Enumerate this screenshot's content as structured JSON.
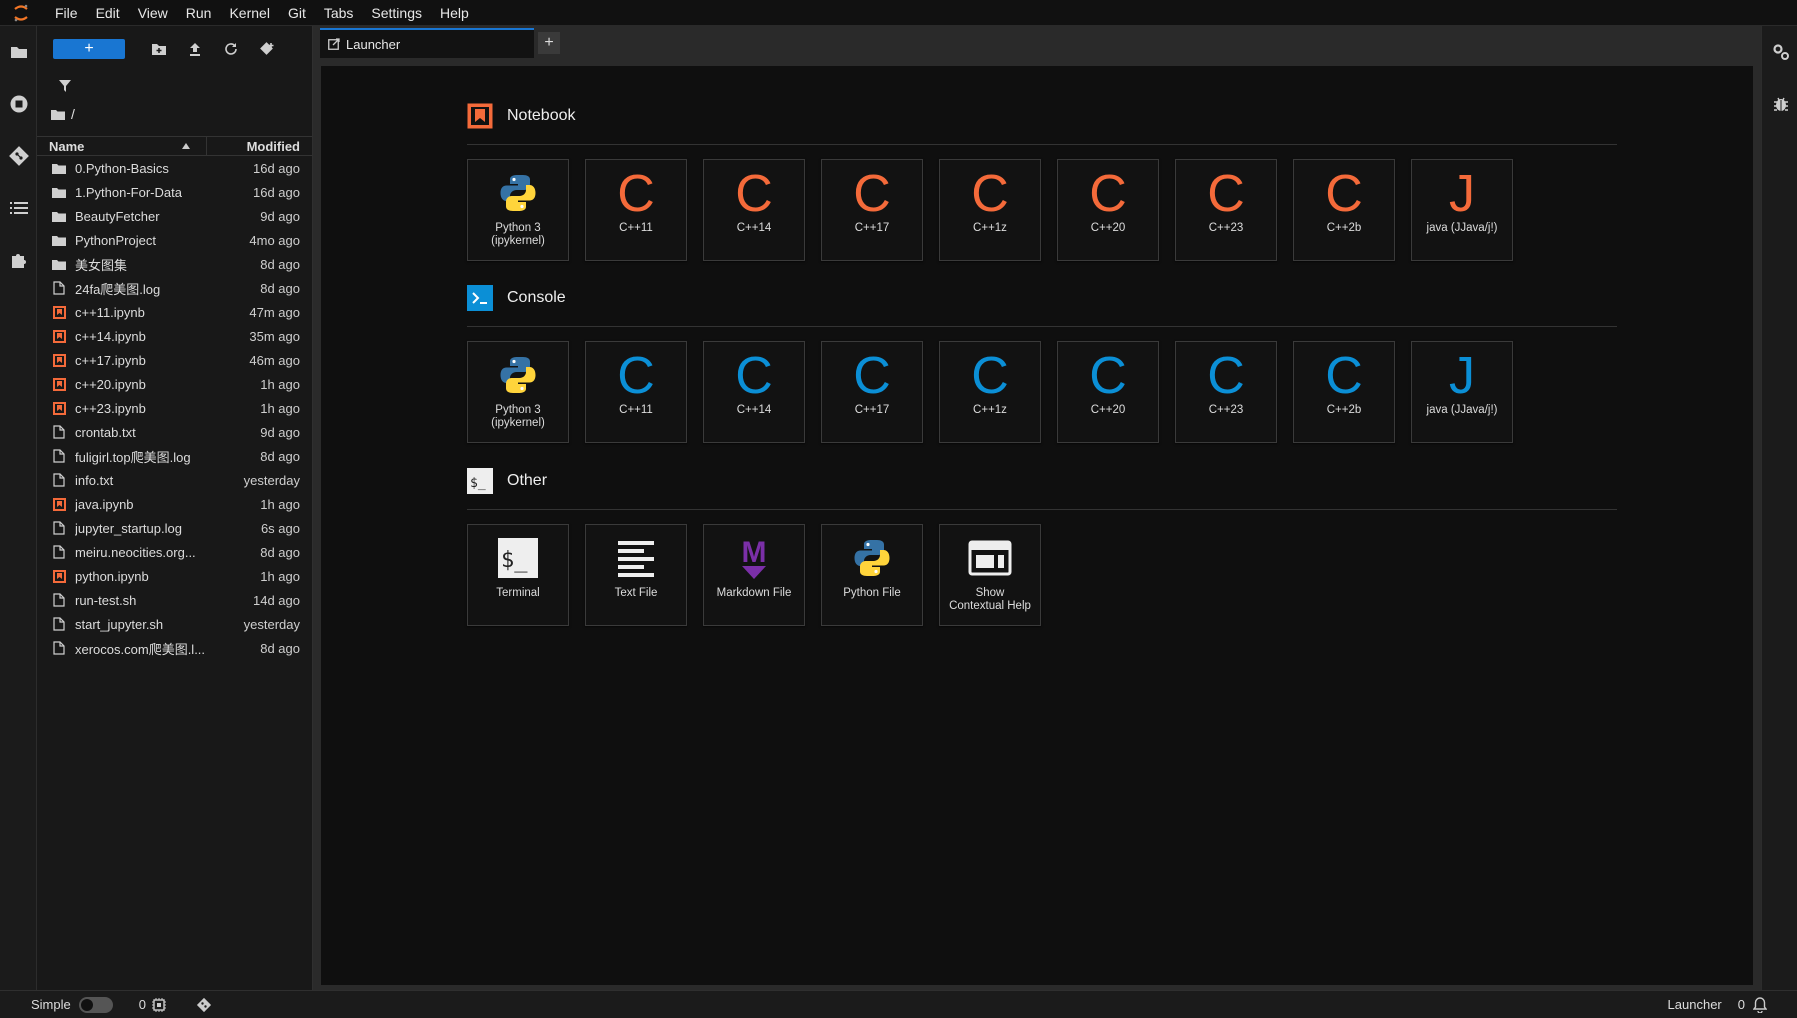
{
  "menu": [
    "File",
    "Edit",
    "View",
    "Run",
    "Kernel",
    "Git",
    "Tabs",
    "Settings",
    "Help"
  ],
  "filebrowser": {
    "new_label": "+",
    "path": "/",
    "col_name": "Name",
    "col_modified": "Modified",
    "files": [
      {
        "name": "0.Python-Basics",
        "modified": "16d ago",
        "type": "folder"
      },
      {
        "name": "1.Python-For-Data",
        "modified": "16d ago",
        "type": "folder"
      },
      {
        "name": "BeautyFetcher",
        "modified": "9d ago",
        "type": "folder"
      },
      {
        "name": "PythonProject",
        "modified": "4mo ago",
        "type": "folder"
      },
      {
        "name": "美女图集",
        "modified": "8d ago",
        "type": "folder"
      },
      {
        "name": "24fa爬美图.log",
        "modified": "8d ago",
        "type": "file"
      },
      {
        "name": "c++11.ipynb",
        "modified": "47m ago",
        "type": "notebook"
      },
      {
        "name": "c++14.ipynb",
        "modified": "35m ago",
        "type": "notebook"
      },
      {
        "name": "c++17.ipynb",
        "modified": "46m ago",
        "type": "notebook"
      },
      {
        "name": "c++20.ipynb",
        "modified": "1h ago",
        "type": "notebook"
      },
      {
        "name": "c++23.ipynb",
        "modified": "1h ago",
        "type": "notebook"
      },
      {
        "name": "crontab.txt",
        "modified": "9d ago",
        "type": "file"
      },
      {
        "name": "fuligirl.top爬美图.log",
        "modified": "8d ago",
        "type": "file"
      },
      {
        "name": "info.txt",
        "modified": "yesterday",
        "type": "file"
      },
      {
        "name": "java.ipynb",
        "modified": "1h ago",
        "type": "notebook"
      },
      {
        "name": "jupyter_startup.log",
        "modified": "6s ago",
        "type": "file"
      },
      {
        "name": "meiru.neocities.org...",
        "modified": "8d ago",
        "type": "file"
      },
      {
        "name": "python.ipynb",
        "modified": "1h ago",
        "type": "notebook"
      },
      {
        "name": "run-test.sh",
        "modified": "14d ago",
        "type": "file"
      },
      {
        "name": "start_jupyter.sh",
        "modified": "yesterday",
        "type": "file"
      },
      {
        "name": "xerocos.com爬美图.l...",
        "modified": "8d ago",
        "type": "file"
      }
    ]
  },
  "tab": {
    "label": "Launcher",
    "add_label": "+"
  },
  "launcher": {
    "notebook": {
      "title": "Notebook",
      "cards": [
        {
          "kind": "python",
          "line1": "Python 3",
          "line2": "(ipykernel)"
        },
        {
          "kind": "letter",
          "letter": "C",
          "line1": "C++11"
        },
        {
          "kind": "letter",
          "letter": "C",
          "line1": "C++14"
        },
        {
          "kind": "letter",
          "letter": "C",
          "line1": "C++17"
        },
        {
          "kind": "letter",
          "letter": "C",
          "line1": "C++1z"
        },
        {
          "kind": "letter",
          "letter": "C",
          "line1": "C++20"
        },
        {
          "kind": "letter",
          "letter": "C",
          "line1": "C++23"
        },
        {
          "kind": "letter",
          "letter": "C",
          "line1": "C++2b"
        },
        {
          "kind": "letter",
          "letter": "J",
          "line1": "java (JJava/j!)"
        }
      ]
    },
    "console": {
      "title": "Console",
      "cards": [
        {
          "kind": "python",
          "line1": "Python 3",
          "line2": "(ipykernel)"
        },
        {
          "kind": "letter",
          "letter": "C",
          "line1": "C++11"
        },
        {
          "kind": "letter",
          "letter": "C",
          "line1": "C++14"
        },
        {
          "kind": "letter",
          "letter": "C",
          "line1": "C++17"
        },
        {
          "kind": "letter",
          "letter": "C",
          "line1": "C++1z"
        },
        {
          "kind": "letter",
          "letter": "C",
          "line1": "C++20"
        },
        {
          "kind": "letter",
          "letter": "C",
          "line1": "C++23"
        },
        {
          "kind": "letter",
          "letter": "C",
          "line1": "C++2b"
        },
        {
          "kind": "letter",
          "letter": "J",
          "line1": "java (JJava/j!)"
        }
      ]
    },
    "other": {
      "title": "Other",
      "cards": [
        {
          "kind": "terminal",
          "line1": "Terminal"
        },
        {
          "kind": "textfile",
          "line1": "Text File"
        },
        {
          "kind": "markdown",
          "line1": "Markdown File"
        },
        {
          "kind": "python",
          "line1": "Python File"
        },
        {
          "kind": "help",
          "line1": "Show",
          "line2": "Contextual Help"
        }
      ]
    }
  },
  "statusbar": {
    "mode_label": "Simple",
    "kernels_count": "0",
    "right_label": "Launcher",
    "notifications_count": "0"
  },
  "colors": {
    "accent": "#1976d2",
    "notebook_letter": "#f46a3a",
    "console_letter": "#0b8fd6",
    "markdown": "#7b2fa8"
  }
}
